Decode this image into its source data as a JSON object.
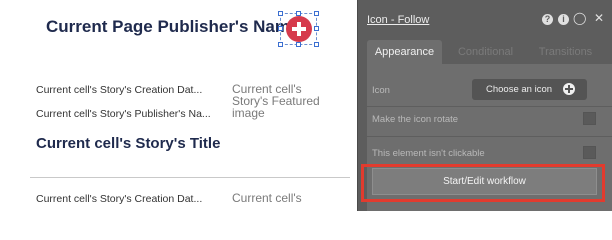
{
  "canvas": {
    "page_title": "Current Page Publisher's Name",
    "cell_creation_date": "Current cell's Story's Creation Dat...",
    "cell_publisher_name": "Current cell's Story's Publisher's Na...",
    "featured_image": "Current cell's Story's Featured image",
    "story_title": "Current cell's Story's Title",
    "cell_creation_date_2": "Current cell's Story's Creation Dat...",
    "featured_image_2": "Current cell's"
  },
  "panel": {
    "title": "Icon - Follow",
    "tabs": [
      {
        "label": "Appearance",
        "active": true
      },
      {
        "label": "Conditional",
        "active": false
      },
      {
        "label": "Transitions",
        "active": false
      }
    ],
    "icon_label": "Icon",
    "choose_icon_button": "Choose an icon",
    "make_rotate_label": "Make the icon rotate",
    "not_clickable_label": "This element isn't clickable",
    "workflow_button": "Start/Edit workflow",
    "icons": [
      "help-icon",
      "info-icon",
      "comment-icon",
      "close-icon"
    ],
    "highlight_color": "#e23b2e",
    "panel_color": "#5d5d5d"
  }
}
